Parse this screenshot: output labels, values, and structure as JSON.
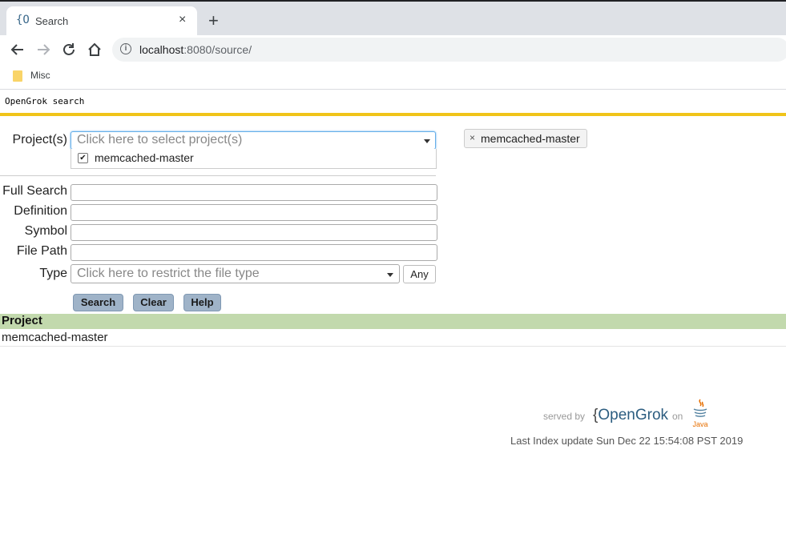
{
  "browser": {
    "tab_icon": "{O",
    "tab_title": "Search",
    "tab_close": "×",
    "new_tab": "+",
    "url_host": "localhost",
    "url_rest": ":8080/source/",
    "bookmark_label": "Misc"
  },
  "page": {
    "header": "OpenGrok search",
    "projects_label": "Project(s)",
    "projects_placeholder": "Click here to select project(s)",
    "dropdown_option": "memcached-master",
    "selected_chip": "memcached-master",
    "chip_remove": "×",
    "full_search_label": "Full Search",
    "definition_label": "Definition",
    "symbol_label": "Symbol",
    "file_path_label": "File Path",
    "type_label": "Type",
    "type_placeholder": "Click here to restrict the file type",
    "any_label": "Any",
    "search_button": "Search",
    "clear_button": "Clear",
    "help_button": "Help",
    "project_column": "Project",
    "project_row": "memcached-master"
  },
  "footer": {
    "served_by": "served by",
    "brand_brace": "{",
    "brand_name": "OpenGrok",
    "on": "on",
    "java": "Java",
    "last_update": "Last Index update Sun Dec 22 15:54:08 PST 2019"
  },
  "colors": {
    "accent_bar": "#f0c419",
    "project_header": "#c2d9ad",
    "button": "#9fb3c8"
  }
}
